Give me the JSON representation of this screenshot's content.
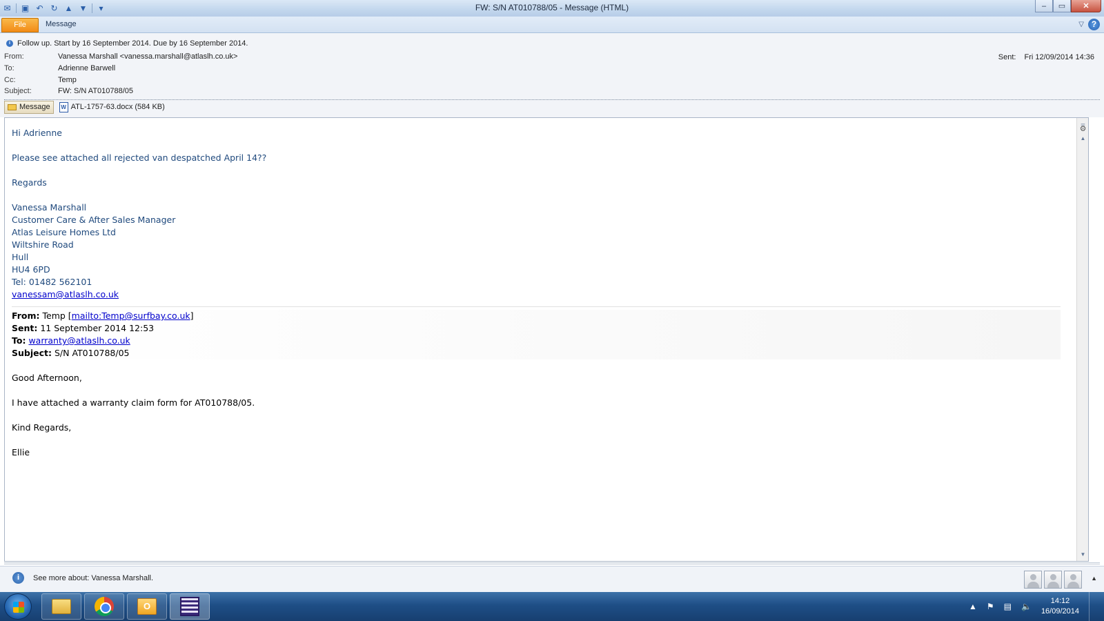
{
  "window": {
    "title": "FW: S/N AT010788/05  -  Message (HTML)",
    "quick_access": [
      "save-icon",
      "undo-icon",
      "redo-icon",
      "up-arrow-icon",
      "down-arrow-icon",
      "customize-icon"
    ],
    "controls": {
      "minimize": "–",
      "restore": "▭",
      "close": "✕"
    }
  },
  "ribbon": {
    "file_label": "File",
    "message_label": "Message",
    "help_label": "?"
  },
  "header": {
    "info": "Follow up.  Start by 16 September 2014.  Due by 16 September 2014.",
    "from_label": "From:",
    "from_value": "Vanessa Marshall <vanessa.marshall@atlaslh.co.uk>",
    "to_label": "To:",
    "to_value": "Adrienne Barwell",
    "cc_label": "Cc:",
    "cc_value": "Temp",
    "subject_label": "Subject:",
    "subject_value": "FW: S/N AT010788/05",
    "sent_label": "Sent:",
    "sent_value": "Fri 12/09/2014 14:36",
    "message_button": "Message",
    "attachment": "ATL-1757-63.docx (584 KB)"
  },
  "body": {
    "greeting": "Hi Adrienne",
    "line1": "Please see attached all rejected van despatched April 14??",
    "regards": "Regards",
    "signature": {
      "name": "Vanessa Marshall",
      "title": "Customer Care & After Sales Manager",
      "company": "Atlas Leisure Homes Ltd",
      "street": "Wiltshire Road",
      "city": "Hull",
      "postcode": "HU4 6PD",
      "tel": "Tel: 01482 562101",
      "email": "vanessam@atlaslh.co.uk"
    },
    "forwarded": {
      "from_label": "From:",
      "from_name": "Temp [",
      "from_link": "mailto:Temp@surfbay.co.uk",
      "from_tail": "]",
      "sent_label": "Sent:",
      "sent_value": "11 September 2014 12:53",
      "to_label": "To:",
      "to_link": "warranty@atlaslh.co.uk",
      "subject_label": "Subject:",
      "subject_value": "S/N AT010788/05",
      "greeting": "Good Afternoon,",
      "line1": "I have attached a warranty claim form for AT010788/05.",
      "closing": "Kind Regards,",
      "signoff": "Ellie"
    }
  },
  "people_pane": {
    "text": "See more about: Vanessa Marshall."
  },
  "taskbar": {
    "time": "14:12",
    "date": "16/09/2014"
  }
}
